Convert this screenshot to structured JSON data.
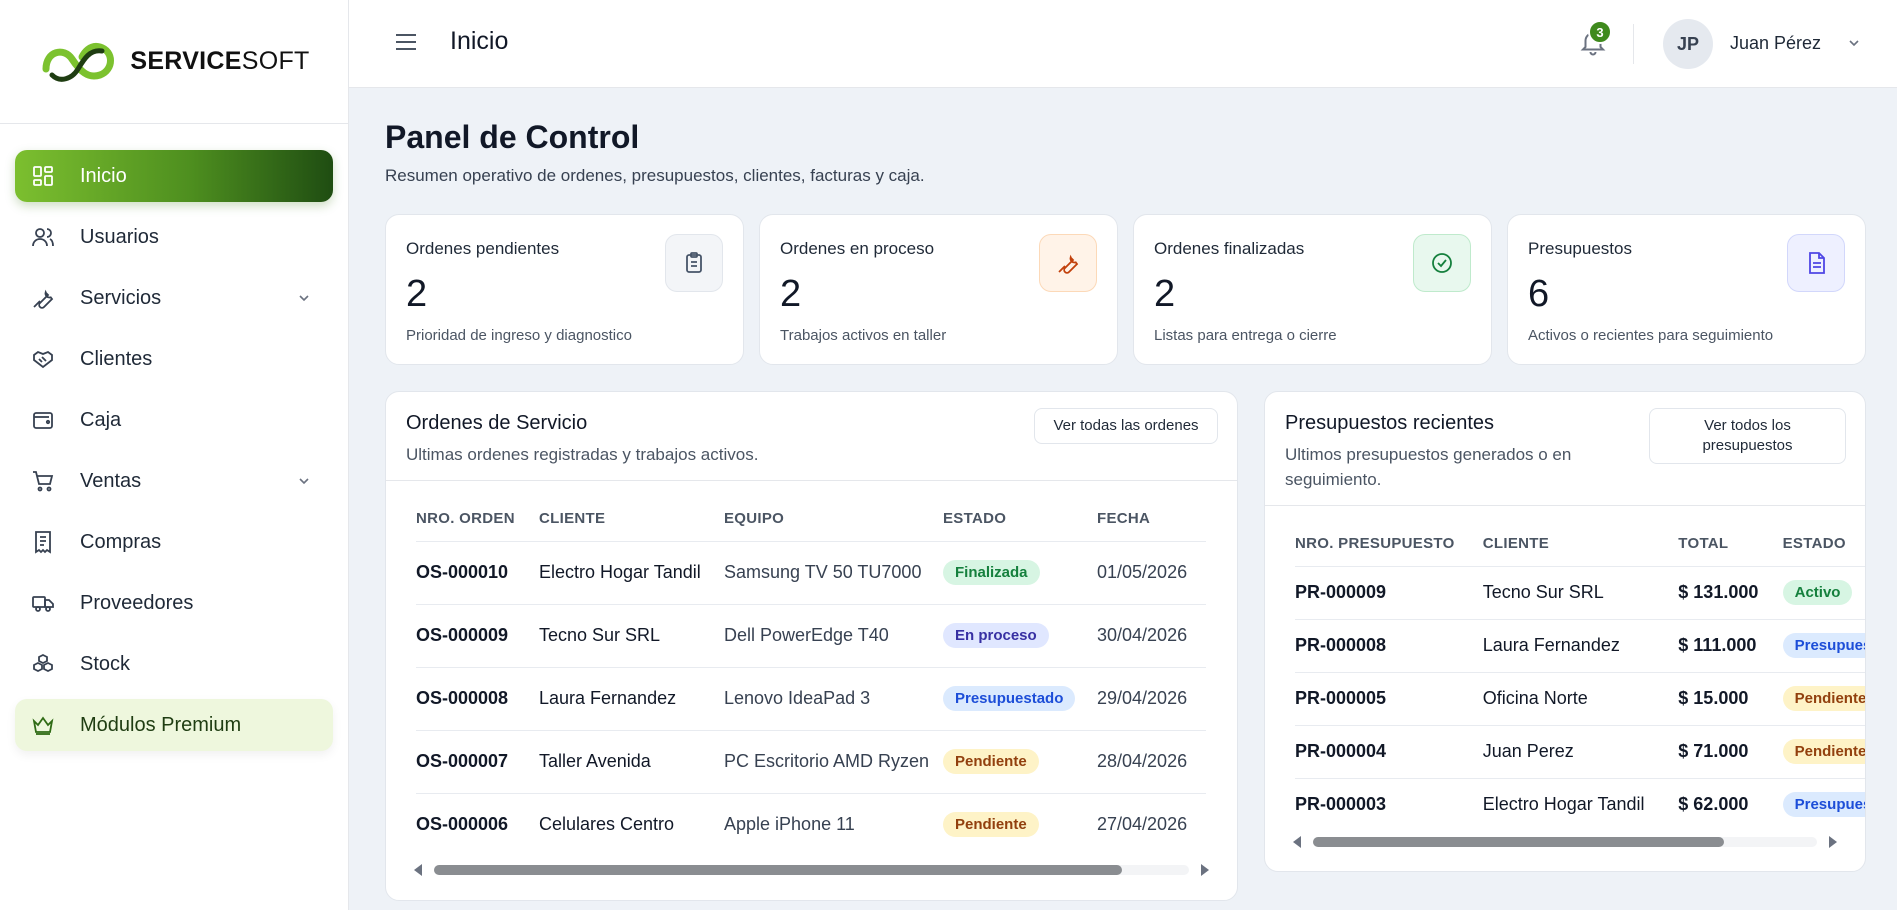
{
  "brand": {
    "logo_bold": "SERVICE",
    "logo_light": "SOFT"
  },
  "sidebar": {
    "items": [
      {
        "label": "Inicio",
        "icon": "grid-icon",
        "active": true
      },
      {
        "label": "Usuarios",
        "icon": "users-icon"
      },
      {
        "label": "Servicios",
        "icon": "wrench-icon",
        "expandable": true
      },
      {
        "label": "Clientes",
        "icon": "handshake-icon"
      },
      {
        "label": "Caja",
        "icon": "wallet-icon"
      },
      {
        "label": "Ventas",
        "icon": "cart-icon",
        "expandable": true
      },
      {
        "label": "Compras",
        "icon": "receipt-icon"
      },
      {
        "label": "Proveedores",
        "icon": "truck-icon"
      },
      {
        "label": "Stock",
        "icon": "boxes-icon"
      },
      {
        "label": "Módulos Premium",
        "icon": "crown-icon",
        "premium": true
      }
    ]
  },
  "header": {
    "title": "Inicio",
    "notifications": "3",
    "user_initials": "JP",
    "user_name": "Juan Pérez"
  },
  "main": {
    "title": "Panel de Control",
    "subtitle": "Resumen operativo de ordenes, presupuestos, clientes, facturas y caja."
  },
  "stats": [
    {
      "label": "Ordenes pendientes",
      "value": "2",
      "desc": "Prioridad de ingreso y diagnostico",
      "icon": "clipboard-icon",
      "color": "#475569",
      "bg": "#f3f5f8"
    },
    {
      "label": "Ordenes en proceso",
      "value": "2",
      "desc": "Trabajos activos en taller",
      "icon": "wrench-icon",
      "color": "#c2410c",
      "bg": "#fff3e8"
    },
    {
      "label": "Ordenes finalizadas",
      "value": "2",
      "desc": "Listas para entrega o cierre",
      "icon": "check-circle-icon",
      "color": "#15803d",
      "bg": "#e8f8ee"
    },
    {
      "label": "Presupuestos",
      "value": "6",
      "desc": "Activos o recientes para seguimiento",
      "icon": "document-icon",
      "color": "#4f46e5",
      "bg": "#eef0ff"
    }
  ],
  "orders": {
    "title": "Ordenes de Servicio",
    "subtitle": "Ultimas ordenes registradas y trabajos activos.",
    "button": "Ver todas las ordenes",
    "columns": [
      "NRO. ORDEN",
      "CLIENTE",
      "EQUIPO",
      "ESTADO",
      "FECHA"
    ],
    "rows": [
      {
        "code": "OS-000010",
        "client": "Electro Hogar Tandil",
        "equipment": "Samsung TV 50 TU7000",
        "status": "Finalizada",
        "date": "01/05/2026"
      },
      {
        "code": "OS-000009",
        "client": "Tecno Sur SRL",
        "equipment": "Dell PowerEdge T40",
        "status": "En proceso",
        "date": "30/04/2026"
      },
      {
        "code": "OS-000008",
        "client": "Laura Fernandez",
        "equipment": "Lenovo IdeaPad 3",
        "status": "Presupuestado",
        "date": "29/04/2026"
      },
      {
        "code": "OS-000007",
        "client": "Taller Avenida",
        "equipment": "PC Escritorio AMD Ryzen",
        "status": "Pendiente",
        "date": "28/04/2026"
      },
      {
        "code": "OS-000006",
        "client": "Celulares Centro",
        "equipment": "Apple iPhone 11",
        "status": "Pendiente",
        "date": "27/04/2026"
      }
    ]
  },
  "quotes": {
    "title": "Presupuestos recientes",
    "subtitle_1": "Ultimos presupuestos generados o en",
    "subtitle_2": "seguimiento.",
    "button_1": "Ver todos los",
    "button_2": "presupuestos",
    "columns": [
      "NRO. PRESUPUESTO",
      "CLIENTE",
      "TOTAL",
      "ESTADO"
    ],
    "rows": [
      {
        "code": "PR-000009",
        "client": "Tecno Sur SRL",
        "total": "$ 131.000",
        "status": "Activo"
      },
      {
        "code": "PR-000008",
        "client": "Laura Fernandez",
        "total": "$ 111.000",
        "status": "Presupuestado"
      },
      {
        "code": "PR-000005",
        "client": "Oficina Norte",
        "total": "$ 15.000",
        "status": "Pendiente"
      },
      {
        "code": "PR-000004",
        "client": "Juan Perez",
        "total": "$ 71.000",
        "status": "Pendiente"
      },
      {
        "code": "PR-000003",
        "client": "Electro Hogar Tandil",
        "total": "$ 62.000",
        "status": "Presupuestado"
      }
    ]
  }
}
